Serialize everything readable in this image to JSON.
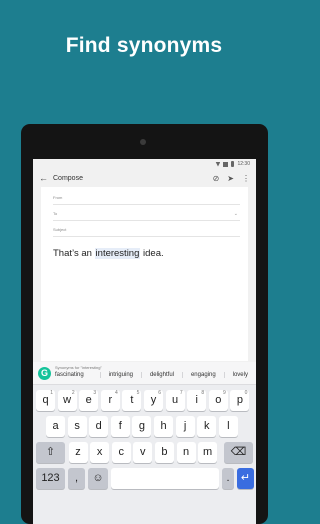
{
  "headline": "Find synonyms",
  "status": {
    "time": "12:30"
  },
  "appbar": {
    "title": "Compose",
    "back_icon": "arrow-left-icon",
    "attach_icon": "attach-icon",
    "send_icon": "send-icon",
    "menu_icon": "more-vertical-icon"
  },
  "compose": {
    "from_label": "From",
    "to_label": "To",
    "subject_label": "Subject",
    "body_before": "That’s an ",
    "body_highlight": "interesting",
    "body_after": " idea."
  },
  "grammarly": {
    "logo": "G",
    "label": "Synonyms for \"interesting\"",
    "suggestions": [
      "fascinating",
      "intriguing",
      "delightful",
      "engaging",
      "lovely"
    ]
  },
  "keyboard": {
    "row1": [
      {
        "key": "q",
        "hint": "1"
      },
      {
        "key": "w",
        "hint": "2"
      },
      {
        "key": "e",
        "hint": "3"
      },
      {
        "key": "r",
        "hint": "4"
      },
      {
        "key": "t",
        "hint": "5"
      },
      {
        "key": "y",
        "hint": "6"
      },
      {
        "key": "u",
        "hint": "7"
      },
      {
        "key": "i",
        "hint": "8"
      },
      {
        "key": "o",
        "hint": "9"
      },
      {
        "key": "p",
        "hint": "0"
      }
    ],
    "row2": [
      "a",
      "s",
      "d",
      "f",
      "g",
      "h",
      "j",
      "k",
      "l"
    ],
    "row3": [
      "z",
      "x",
      "c",
      "v",
      "b",
      "n",
      "m"
    ],
    "shift": "⇧",
    "backspace": "⌫",
    "numbers": "123",
    "comma": ",",
    "emoji": "☺",
    "period": ".",
    "enter": "↵"
  },
  "colors": {
    "background": "#1d7e8f",
    "enter_key": "#3a6de0",
    "grammarly": "#15c39a"
  }
}
